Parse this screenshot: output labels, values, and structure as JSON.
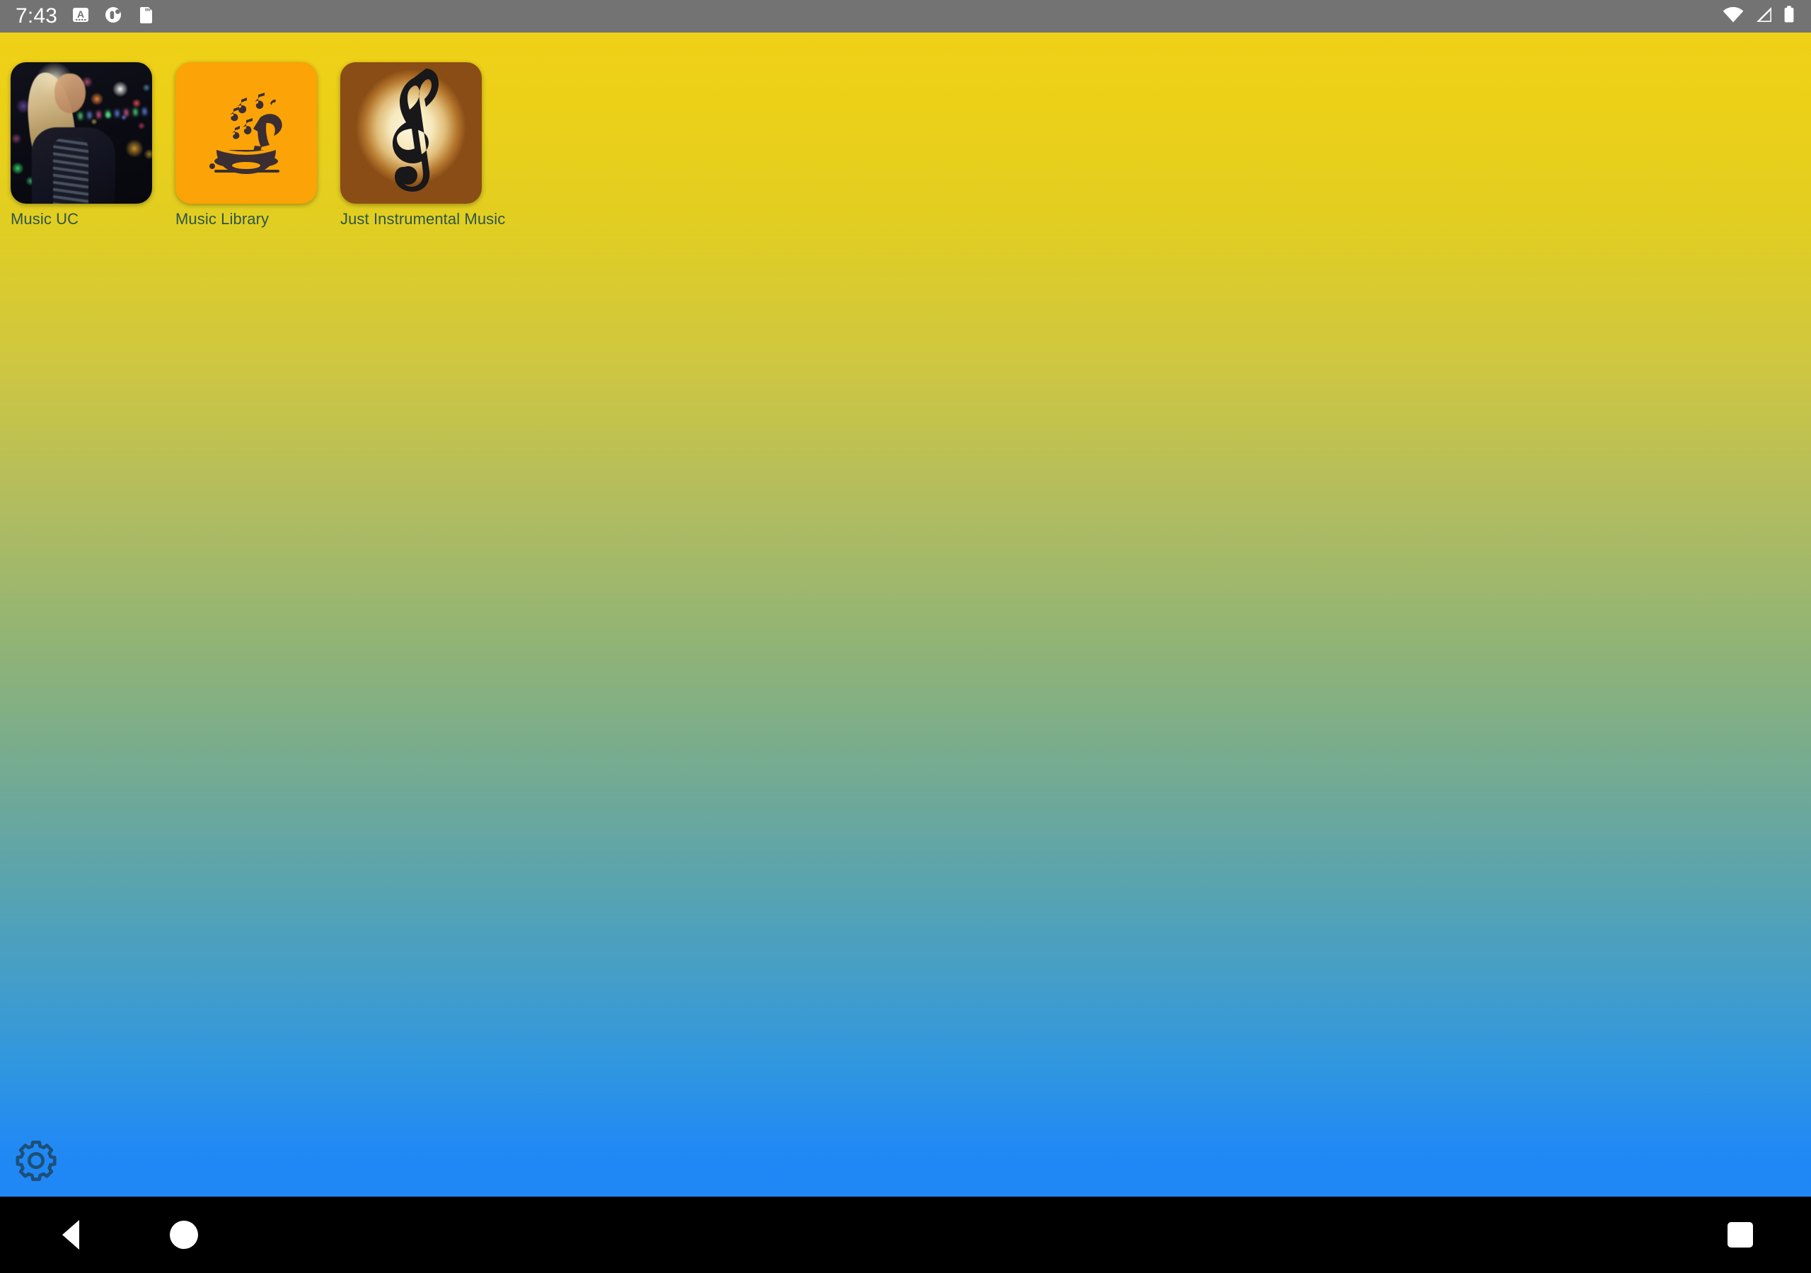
{
  "status_bar": {
    "clock": "7:43",
    "left_icons": [
      {
        "name": "keyboard-language-icon",
        "glyph": "A"
      },
      {
        "name": "app-notification-icon",
        "glyph": "circle"
      },
      {
        "name": "sd-card-icon",
        "glyph": "sd"
      }
    ],
    "right_icons": [
      {
        "name": "wifi-icon",
        "label": "Wi-Fi"
      },
      {
        "name": "cellular-signal-icon",
        "label": "Signal"
      },
      {
        "name": "battery-icon",
        "label": "Battery"
      }
    ],
    "background_color": "#737373",
    "text_color": "#ffffff"
  },
  "wallpaper": {
    "top_color": "#efd117",
    "mid_color": "#87b281",
    "bottom_color": "#1f87f6",
    "description": "vertical gradient yellow to green to blue"
  },
  "home_screen": {
    "label_color": "#2d5549",
    "apps": [
      {
        "name": "music-uc",
        "label": "Music UC",
        "icon_kind": "photo",
        "icon_description": "blonde woman at a nightclub with colorful bokeh lights"
      },
      {
        "name": "music-library",
        "label": "Music Library",
        "icon_kind": "gramophone",
        "icon_background": "#fba307",
        "icon_foreground": "#3c2f35",
        "icon_description": "dark gramophone horn with musical notes on orange background"
      },
      {
        "name": "just-instrumental-music",
        "label": "Just Instrumental Music",
        "icon_kind": "treble-clef",
        "icon_background": "#f2e0ae",
        "icon_foreground": "#1b1a18",
        "icon_description": "black treble clef on sepia parchment background"
      }
    ]
  },
  "settings": {
    "name": "settings-gear",
    "label": "Settings",
    "color": "#1d4f7a"
  },
  "nav_bar": {
    "background_color": "#000000",
    "buttons": [
      {
        "name": "back-button",
        "label": "Back",
        "shape": "triangle"
      },
      {
        "name": "home-button",
        "label": "Home",
        "shape": "circle"
      },
      {
        "name": "recents-button",
        "label": "Recents",
        "shape": "square"
      }
    ]
  }
}
